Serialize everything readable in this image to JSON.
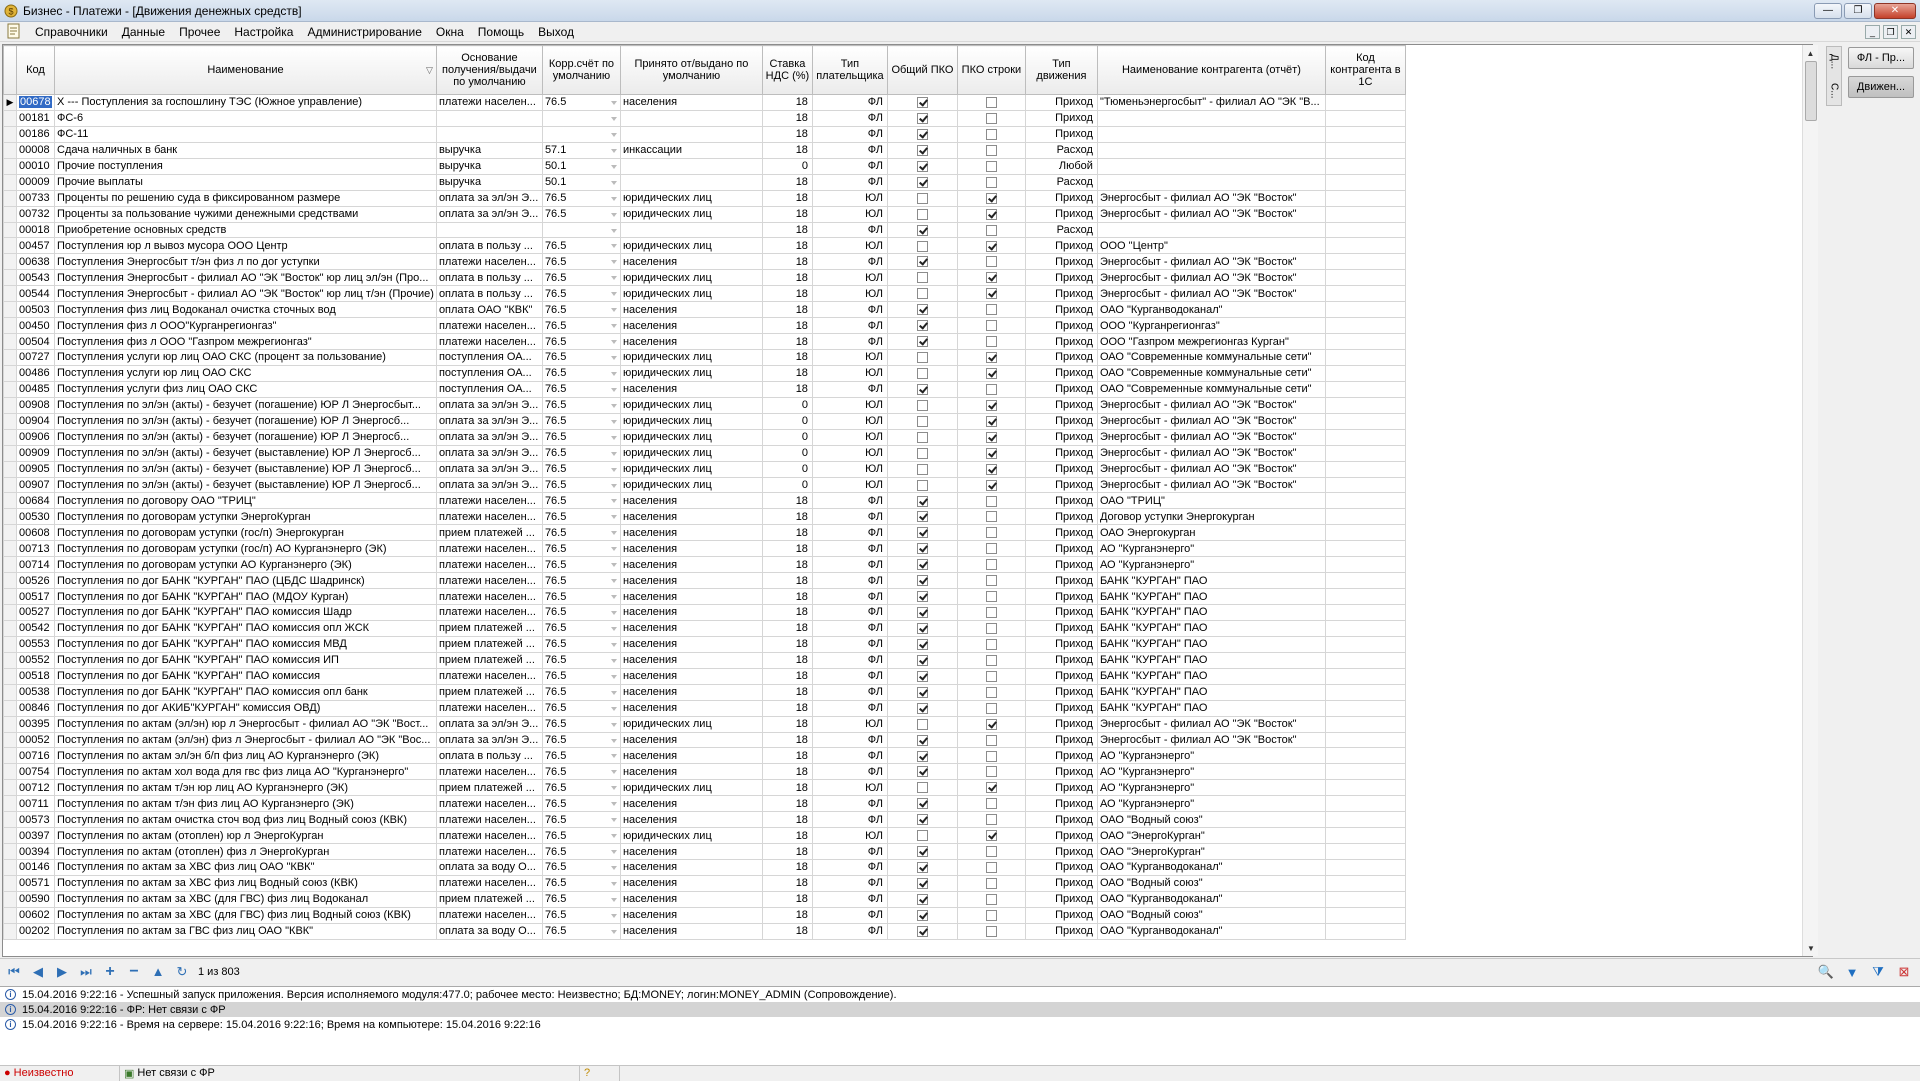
{
  "window": {
    "title": "Бизнес - Платежи - [Движения денежных средств]",
    "min": "—",
    "max": "❐",
    "close": "✕"
  },
  "menu": [
    "Справочники",
    "Данные",
    "Прочее",
    "Настройка",
    "Администрирование",
    "Окна",
    "Помощь",
    "Выход"
  ],
  "columns": [
    "Код",
    "Наименование",
    "Основание получения/выдачи по умолчанию",
    "Корр.счёт по умолчанию",
    "Принято от/выдано по умолчанию",
    "Ставка НДС (%)",
    "Тип плательщика",
    "Общий ПКО",
    "ПКО строки",
    "Тип движения",
    "Наименование контрагента (отчёт)",
    "Код контрагента в 1С"
  ],
  "rows": [
    {
      "code": "00678",
      "name": "Х --- Поступления за госпошлину ТЭС (Южное управление)",
      "basis": "платежи населен...",
      "acct": "76.5",
      "from": "населения",
      "vat": "18",
      "ptype": "ФЛ",
      "pko": true,
      "pkos": false,
      "move": "Приход",
      "cp": "\"Тюменьэнергосбыт\" - филиал АО \"ЭК \"В...",
      "code1c": ""
    },
    {
      "code": "00181",
      "name": "ФС-6",
      "basis": "",
      "acct": "",
      "from": "",
      "vat": "18",
      "ptype": "ФЛ",
      "pko": true,
      "pkos": false,
      "move": "Приход",
      "cp": "",
      "code1c": ""
    },
    {
      "code": "00186",
      "name": "ФС-11",
      "basis": "",
      "acct": "",
      "from": "",
      "vat": "18",
      "ptype": "ФЛ",
      "pko": true,
      "pkos": false,
      "move": "Приход",
      "cp": "",
      "code1c": ""
    },
    {
      "code": "00008",
      "name": "Сдача наличных в банк",
      "basis": "выручка",
      "acct": "57.1",
      "from": "инкассации",
      "vat": "18",
      "ptype": "ФЛ",
      "pko": true,
      "pkos": false,
      "move": "Расход",
      "cp": "",
      "code1c": ""
    },
    {
      "code": "00010",
      "name": "Прочие поступления",
      "basis": "выручка",
      "acct": "50.1",
      "from": "",
      "vat": "0",
      "ptype": "ФЛ",
      "pko": true,
      "pkos": false,
      "move": "Любой",
      "cp": "",
      "code1c": ""
    },
    {
      "code": "00009",
      "name": "Прочие выплаты",
      "basis": "выручка",
      "acct": "50.1",
      "from": "",
      "vat": "18",
      "ptype": "ФЛ",
      "pko": true,
      "pkos": false,
      "move": "Расход",
      "cp": "",
      "code1c": ""
    },
    {
      "code": "00733",
      "name": "Проценты по решению суда в фиксированном размере",
      "basis": "оплата за эл/эн Э...",
      "acct": "76.5",
      "from": "юридических лиц",
      "vat": "18",
      "ptype": "ЮЛ",
      "pko": false,
      "pkos": true,
      "move": "Приход",
      "cp": "Энергосбыт - филиал АО \"ЭК \"Восток\"",
      "code1c": ""
    },
    {
      "code": "00732",
      "name": "Проценты за пользование чужими денежными средствами",
      "basis": "оплата за эл/эн Э...",
      "acct": "76.5",
      "from": "юридических лиц",
      "vat": "18",
      "ptype": "ЮЛ",
      "pko": false,
      "pkos": true,
      "move": "Приход",
      "cp": "Энергосбыт - филиал АО \"ЭК \"Восток\"",
      "code1c": ""
    },
    {
      "code": "00018",
      "name": "Приобретение основных средств",
      "basis": "",
      "acct": "",
      "from": "",
      "vat": "18",
      "ptype": "ФЛ",
      "pko": true,
      "pkos": false,
      "move": "Расход",
      "cp": "",
      "code1c": ""
    },
    {
      "code": "00457",
      "name": "Поступления юр л вывоз мусора ООО Центр",
      "basis": "оплата в пользу ...",
      "acct": "76.5",
      "from": "юридических лиц",
      "vat": "18",
      "ptype": "ЮЛ",
      "pko": false,
      "pkos": true,
      "move": "Приход",
      "cp": "ООО \"Центр\"",
      "code1c": ""
    },
    {
      "code": "00638",
      "name": "Поступления Энергосбыт т/эн физ л по дог уступки",
      "basis": "платежи населен...",
      "acct": "76.5",
      "from": "населения",
      "vat": "18",
      "ptype": "ФЛ",
      "pko": true,
      "pkos": false,
      "move": "Приход",
      "cp": "Энергосбыт - филиал АО \"ЭК \"Восток\"",
      "code1c": ""
    },
    {
      "code": "00543",
      "name": "Поступления Энергосбыт - филиал АО \"ЭК \"Восток\" юр лиц эл/эн (Про...",
      "basis": "оплата в пользу ...",
      "acct": "76.5",
      "from": "юридических лиц",
      "vat": "18",
      "ptype": "ЮЛ",
      "pko": false,
      "pkos": true,
      "move": "Приход",
      "cp": "Энергосбыт - филиал АО \"ЭК \"Восток\"",
      "code1c": ""
    },
    {
      "code": "00544",
      "name": "Поступления Энергосбыт - филиал АО \"ЭК \"Восток\" юр лиц т/эн (Прочие)",
      "basis": "оплата в пользу ...",
      "acct": "76.5",
      "from": "юридических лиц",
      "vat": "18",
      "ptype": "ЮЛ",
      "pko": false,
      "pkos": true,
      "move": "Приход",
      "cp": "Энергосбыт - филиал АО \"ЭК \"Восток\"",
      "code1c": ""
    },
    {
      "code": "00503",
      "name": "Поступления физ лиц Водоканал очистка сточных вод",
      "basis": "оплата ОАО \"КВК\"",
      "acct": "76.5",
      "from": "населения",
      "vat": "18",
      "ptype": "ФЛ",
      "pko": true,
      "pkos": false,
      "move": "Приход",
      "cp": "ОАО \"Курганводоканал\"",
      "code1c": ""
    },
    {
      "code": "00450",
      "name": "Поступления физ л ООО\"Курганрегионгаз\"",
      "basis": "платежи населен...",
      "acct": "76.5",
      "from": "населения",
      "vat": "18",
      "ptype": "ФЛ",
      "pko": true,
      "pkos": false,
      "move": "Приход",
      "cp": "ООО \"Курганрегионгаз\"",
      "code1c": ""
    },
    {
      "code": "00504",
      "name": "Поступления физ л ООО \"Газпром межрегионгаз\"",
      "basis": "платежи населен...",
      "acct": "76.5",
      "from": "населения",
      "vat": "18",
      "ptype": "ФЛ",
      "pko": true,
      "pkos": false,
      "move": "Приход",
      "cp": "ООО \"Газпром межрегионгаз Курган\"",
      "code1c": ""
    },
    {
      "code": "00727",
      "name": "Поступления услуги юр лиц ОАО СКС (процент за пользование)",
      "basis": "поступления ОА...",
      "acct": "76.5",
      "from": "юридических лиц",
      "vat": "18",
      "ptype": "ЮЛ",
      "pko": false,
      "pkos": true,
      "move": "Приход",
      "cp": "ОАО \"Современные коммунальные сети\"",
      "code1c": ""
    },
    {
      "code": "00486",
      "name": "Поступления услуги юр лиц ОАО СКС",
      "basis": "поступления ОА...",
      "acct": "76.5",
      "from": "юридических лиц",
      "vat": "18",
      "ptype": "ЮЛ",
      "pko": false,
      "pkos": true,
      "move": "Приход",
      "cp": "ОАО \"Современные коммунальные сети\"",
      "code1c": ""
    },
    {
      "code": "00485",
      "name": "Поступления услуги физ лиц ОАО СКС",
      "basis": "поступления ОА...",
      "acct": "76.5",
      "from": "населения",
      "vat": "18",
      "ptype": "ФЛ",
      "pko": true,
      "pkos": false,
      "move": "Приход",
      "cp": "ОАО \"Современные коммунальные сети\"",
      "code1c": ""
    },
    {
      "code": "00908",
      "name": "Поступления по эл/эн (акты) - безучет (погашение) ЮР Л Энергосбыт...",
      "basis": "оплата за эл/эн Э...",
      "acct": "76.5",
      "from": "юридических лиц",
      "vat": "0",
      "ptype": "ЮЛ",
      "pko": false,
      "pkos": true,
      "move": "Приход",
      "cp": "Энергосбыт - филиал АО \"ЭК \"Восток\"",
      "code1c": ""
    },
    {
      "code": "00904",
      "name": "Поступления по эл/эн (акты) - безучет (погашение) ЮР Л Энергосб...",
      "basis": "оплата за эл/эн Э...",
      "acct": "76.5",
      "from": "юридических лиц",
      "vat": "0",
      "ptype": "ЮЛ",
      "pko": false,
      "pkos": true,
      "move": "Приход",
      "cp": "Энергосбыт - филиал АО \"ЭК \"Восток\"",
      "code1c": ""
    },
    {
      "code": "00906",
      "name": "Поступления по эл/эн (акты) - безучет (погашение) ЮР Л Энергосб...",
      "basis": "оплата за эл/эн Э...",
      "acct": "76.5",
      "from": "юридических лиц",
      "vat": "0",
      "ptype": "ЮЛ",
      "pko": false,
      "pkos": true,
      "move": "Приход",
      "cp": "Энергосбыт - филиал АО \"ЭК \"Восток\"",
      "code1c": ""
    },
    {
      "code": "00909",
      "name": "Поступления по эл/эн (акты) - безучет (выставление) ЮР Л Энергосб...",
      "basis": "оплата за эл/эн Э...",
      "acct": "76.5",
      "from": "юридических лиц",
      "vat": "0",
      "ptype": "ЮЛ",
      "pko": false,
      "pkos": true,
      "move": "Приход",
      "cp": "Энергосбыт - филиал АО \"ЭК \"Восток\"",
      "code1c": ""
    },
    {
      "code": "00905",
      "name": "Поступления по эл/эн (акты) - безучет (выставление) ЮР Л Энергосб...",
      "basis": "оплата за эл/эн Э...",
      "acct": "76.5",
      "from": "юридических лиц",
      "vat": "0",
      "ptype": "ЮЛ",
      "pko": false,
      "pkos": true,
      "move": "Приход",
      "cp": "Энергосбыт - филиал АО \"ЭК \"Восток\"",
      "code1c": ""
    },
    {
      "code": "00907",
      "name": "Поступления по эл/эн (акты) - безучет (выставление) ЮР Л Энергосб...",
      "basis": "оплата за эл/эн Э...",
      "acct": "76.5",
      "from": "юридических лиц",
      "vat": "0",
      "ptype": "ЮЛ",
      "pko": false,
      "pkos": true,
      "move": "Приход",
      "cp": "Энергосбыт - филиал АО \"ЭК \"Восток\"",
      "code1c": ""
    },
    {
      "code": "00684",
      "name": "Поступления по договору ОАО \"ТРИЦ\"",
      "basis": "платежи населен...",
      "acct": "76.5",
      "from": "населения",
      "vat": "18",
      "ptype": "ФЛ",
      "pko": true,
      "pkos": false,
      "move": "Приход",
      "cp": "ОАО \"ТРИЦ\"",
      "code1c": ""
    },
    {
      "code": "00530",
      "name": "Поступления по договорам уступки ЭнергоКурган",
      "basis": "платежи населен...",
      "acct": "76.5",
      "from": "населения",
      "vat": "18",
      "ptype": "ФЛ",
      "pko": true,
      "pkos": false,
      "move": "Приход",
      "cp": "Договор уступки Энергокурган",
      "code1c": ""
    },
    {
      "code": "00608",
      "name": "Поступления по договорам уступки (гос/п) Энергокурган",
      "basis": "прием платежей ...",
      "acct": "76.5",
      "from": "населения",
      "vat": "18",
      "ptype": "ФЛ",
      "pko": true,
      "pkos": false,
      "move": "Приход",
      "cp": "ОАО Энергокурган",
      "code1c": ""
    },
    {
      "code": "00713",
      "name": "Поступления по договорам уступки (гос/п) АО Курганэнерго (ЭК)",
      "basis": "платежи населен...",
      "acct": "76.5",
      "from": "населения",
      "vat": "18",
      "ptype": "ФЛ",
      "pko": true,
      "pkos": false,
      "move": "Приход",
      "cp": "АО \"Курганэнерго\"",
      "code1c": ""
    },
    {
      "code": "00714",
      "name": "Поступления по договорам уступки АО Курганэнерго (ЭК)",
      "basis": "платежи населен...",
      "acct": "76.5",
      "from": "населения",
      "vat": "18",
      "ptype": "ФЛ",
      "pko": true,
      "pkos": false,
      "move": "Приход",
      "cp": "АО \"Курганэнерго\"",
      "code1c": ""
    },
    {
      "code": "00526",
      "name": "Поступления по дог БАНК \"КУРГАН\" ПАО (ЦБДС Шадринск)",
      "basis": "платежи населен...",
      "acct": "76.5",
      "from": "населения",
      "vat": "18",
      "ptype": "ФЛ",
      "pko": true,
      "pkos": false,
      "move": "Приход",
      "cp": "БАНК \"КУРГАН\" ПАО",
      "code1c": ""
    },
    {
      "code": "00517",
      "name": "Поступления по дог БАНК \"КУРГАН\" ПАО (МДОУ Курган)",
      "basis": "платежи населен...",
      "acct": "76.5",
      "from": "населения",
      "vat": "18",
      "ptype": "ФЛ",
      "pko": true,
      "pkos": false,
      "move": "Приход",
      "cp": "БАНК \"КУРГАН\" ПАО",
      "code1c": ""
    },
    {
      "code": "00527",
      "name": "Поступления по дог БАНК \"КУРГАН\" ПАО комиссия Шадр",
      "basis": "платежи населен...",
      "acct": "76.5",
      "from": "населения",
      "vat": "18",
      "ptype": "ФЛ",
      "pko": true,
      "pkos": false,
      "move": "Приход",
      "cp": "БАНК \"КУРГАН\" ПАО",
      "code1c": ""
    },
    {
      "code": "00542",
      "name": "Поступления по дог БАНК \"КУРГАН\" ПАО комиссия опл ЖСК",
      "basis": "прием платежей ...",
      "acct": "76.5",
      "from": "населения",
      "vat": "18",
      "ptype": "ФЛ",
      "pko": true,
      "pkos": false,
      "move": "Приход",
      "cp": "БАНК \"КУРГАН\" ПАО",
      "code1c": ""
    },
    {
      "code": "00553",
      "name": "Поступления по дог БАНК \"КУРГАН\" ПАО комиссия МВД",
      "basis": "прием платежей ...",
      "acct": "76.5",
      "from": "населения",
      "vat": "18",
      "ptype": "ФЛ",
      "pko": true,
      "pkos": false,
      "move": "Приход",
      "cp": "БАНК \"КУРГАН\" ПАО",
      "code1c": ""
    },
    {
      "code": "00552",
      "name": "Поступления по дог БАНК \"КУРГАН\" ПАО комиссия ИП",
      "basis": "прием платежей ...",
      "acct": "76.5",
      "from": "населения",
      "vat": "18",
      "ptype": "ФЛ",
      "pko": true,
      "pkos": false,
      "move": "Приход",
      "cp": "БАНК \"КУРГАН\" ПАО",
      "code1c": ""
    },
    {
      "code": "00518",
      "name": "Поступления по дог БАНК \"КУРГАН\" ПАО комиссия",
      "basis": "платежи населен...",
      "acct": "76.5",
      "from": "населения",
      "vat": "18",
      "ptype": "ФЛ",
      "pko": true,
      "pkos": false,
      "move": "Приход",
      "cp": "БАНК \"КУРГАН\" ПАО",
      "code1c": ""
    },
    {
      "code": "00538",
      "name": "Поступления по дог БАНК \"КУРГАН\" ПАО  комиссия опл банк",
      "basis": "прием платежей ...",
      "acct": "76.5",
      "from": "населения",
      "vat": "18",
      "ptype": "ФЛ",
      "pko": true,
      "pkos": false,
      "move": "Приход",
      "cp": "БАНК \"КУРГАН\" ПАО",
      "code1c": ""
    },
    {
      "code": "00846",
      "name": "Поступления по дог АКИБ\"КУРГАН\" комиссия ОВД)",
      "basis": "платежи населен...",
      "acct": "76.5",
      "from": "населения",
      "vat": "18",
      "ptype": "ФЛ",
      "pko": true,
      "pkos": false,
      "move": "Приход",
      "cp": "БАНК \"КУРГАН\" ПАО",
      "code1c": ""
    },
    {
      "code": "00395",
      "name": "Поступления по актам (эл/эн) юр л  Энергосбыт - филиал АО \"ЭК \"Вост...",
      "basis": "оплата за эл/эн Э...",
      "acct": "76.5",
      "from": "юридических лиц",
      "vat": "18",
      "ptype": "ЮЛ",
      "pko": false,
      "pkos": true,
      "move": "Приход",
      "cp": "Энергосбыт - филиал АО \"ЭК \"Восток\"",
      "code1c": ""
    },
    {
      "code": "00052",
      "name": "Поступления по актам (эл/эн) физ л  Энергосбыт - филиал АО \"ЭК \"Вос...",
      "basis": "оплата за эл/эн Э...",
      "acct": "76.5",
      "from": "населения",
      "vat": "18",
      "ptype": "ФЛ",
      "pko": true,
      "pkos": false,
      "move": "Приход",
      "cp": "Энергосбыт - филиал АО \"ЭК \"Восток\"",
      "code1c": ""
    },
    {
      "code": "00716",
      "name": "Поступления по актам эл/эн б/п физ лиц АО Курганэнерго (ЭК)",
      "basis": "оплата в пользу ...",
      "acct": "76.5",
      "from": "населения",
      "vat": "18",
      "ptype": "ФЛ",
      "pko": true,
      "pkos": false,
      "move": "Приход",
      "cp": "АО \"Курганэнерго\"",
      "code1c": ""
    },
    {
      "code": "00754",
      "name": "Поступления по актам хол вода для гвс физ лица АО \"Курганэнерго\"",
      "basis": "платежи населен...",
      "acct": "76.5",
      "from": "населения",
      "vat": "18",
      "ptype": "ФЛ",
      "pko": true,
      "pkos": false,
      "move": "Приход",
      "cp": "АО \"Курганэнерго\"",
      "code1c": ""
    },
    {
      "code": "00712",
      "name": "Поступления по актам т/эн юр лиц АО Курганэнерго (ЭК)",
      "basis": "прием платежей ...",
      "acct": "76.5",
      "from": "юридических лиц",
      "vat": "18",
      "ptype": "ЮЛ",
      "pko": false,
      "pkos": true,
      "move": "Приход",
      "cp": "АО \"Курганэнерго\"",
      "code1c": ""
    },
    {
      "code": "00711",
      "name": "Поступления по актам т/эн физ лиц АО Курганэнерго (ЭК)",
      "basis": "платежи населен...",
      "acct": "76.5",
      "from": "населения",
      "vat": "18",
      "ptype": "ФЛ",
      "pko": true,
      "pkos": false,
      "move": "Приход",
      "cp": "АО \"Курганэнерго\"",
      "code1c": ""
    },
    {
      "code": "00573",
      "name": "Поступления по актам очистка сточ вод физ лиц Водный союз (КВК)",
      "basis": "платежи населен...",
      "acct": "76.5",
      "from": "населения",
      "vat": "18",
      "ptype": "ФЛ",
      "pko": true,
      "pkos": false,
      "move": "Приход",
      "cp": "ОАО \"Водный союз\"",
      "code1c": ""
    },
    {
      "code": "00397",
      "name": "Поступления по актам (отоплен) юр л ЭнергоКурган",
      "basis": "платежи населен...",
      "acct": "76.5",
      "from": "юридических лиц",
      "vat": "18",
      "ptype": "ЮЛ",
      "pko": false,
      "pkos": true,
      "move": "Приход",
      "cp": "ОАО \"ЭнергоКурган\"",
      "code1c": ""
    },
    {
      "code": "00394",
      "name": "Поступления по актам (отоплен) физ л ЭнергоКурган",
      "basis": "платежи населен...",
      "acct": "76.5",
      "from": "населения",
      "vat": "18",
      "ptype": "ФЛ",
      "pko": true,
      "pkos": false,
      "move": "Приход",
      "cp": "ОАО \"ЭнергоКурган\"",
      "code1c": ""
    },
    {
      "code": "00146",
      "name": "Поступления по актам за ХВС физ лиц ОАО \"КВК\"",
      "basis": "оплата за воду О...",
      "acct": "76.5",
      "from": "населения",
      "vat": "18",
      "ptype": "ФЛ",
      "pko": true,
      "pkos": false,
      "move": "Приход",
      "cp": "ОАО \"Курганводоканал\"",
      "code1c": ""
    },
    {
      "code": "00571",
      "name": "Поступления по актам за ХВС физ лиц Водный союз (КВК)",
      "basis": "платежи населен...",
      "acct": "76.5",
      "from": "населения",
      "vat": "18",
      "ptype": "ФЛ",
      "pko": true,
      "pkos": false,
      "move": "Приход",
      "cp": "ОАО \"Водный союз\"",
      "code1c": ""
    },
    {
      "code": "00590",
      "name": "Поступления по актам за ХВС (для ГВС) физ лиц Водоканал",
      "basis": "прием платежей ...",
      "acct": "76.5",
      "from": "населения",
      "vat": "18",
      "ptype": "ФЛ",
      "pko": true,
      "pkos": false,
      "move": "Приход",
      "cp": "ОАО \"Курганводоканал\"",
      "code1c": ""
    },
    {
      "code": "00602",
      "name": "Поступления по актам за ХВС (для ГВС) физ лиц Водный союз (КВК)",
      "basis": "платежи населен...",
      "acct": "76.5",
      "from": "населения",
      "vat": "18",
      "ptype": "ФЛ",
      "pko": true,
      "pkos": false,
      "move": "Приход",
      "cp": "ОАО \"Водный союз\"",
      "code1c": ""
    },
    {
      "code": "00202",
      "name": "Поступления по актам за ГВС физ лиц ОАО \"КВК\"",
      "basis": "оплата за воду О...",
      "acct": "76.5",
      "from": "населения",
      "vat": "18",
      "ptype": "ФЛ",
      "pko": true,
      "pkos": false,
      "move": "Приход",
      "cp": "ОАО \"Курганводоканал\"",
      "code1c": ""
    }
  ],
  "navigation": {
    "record_count": "1 из 803"
  },
  "right_panel": {
    "tab1": "Д...",
    "tab2": "С...",
    "button1": "ФЛ - Пр...",
    "button2": "Движен..."
  },
  "log": [
    "15.04.2016 9:22:16 -  Успешный запуск приложения. Версия исполняемого модуля:477.0; рабочее место: Неизвестно; БД:MONEY; логин:MONEY_ADMIN (Сопровождение).",
    "15.04.2016 9:22:16 -  ФР: Нет связи с ФР",
    "15.04.2016 9:22:16 -  Время на сервере: 15.04.2016 9:22:16; Время на компьютере: 15.04.2016 9:22:16"
  ],
  "status": {
    "left": "Неизвестно",
    "fr": "Нет связи с ФР"
  },
  "colors": {
    "selection": "#316ac5",
    "status_error": "#cc0000"
  }
}
